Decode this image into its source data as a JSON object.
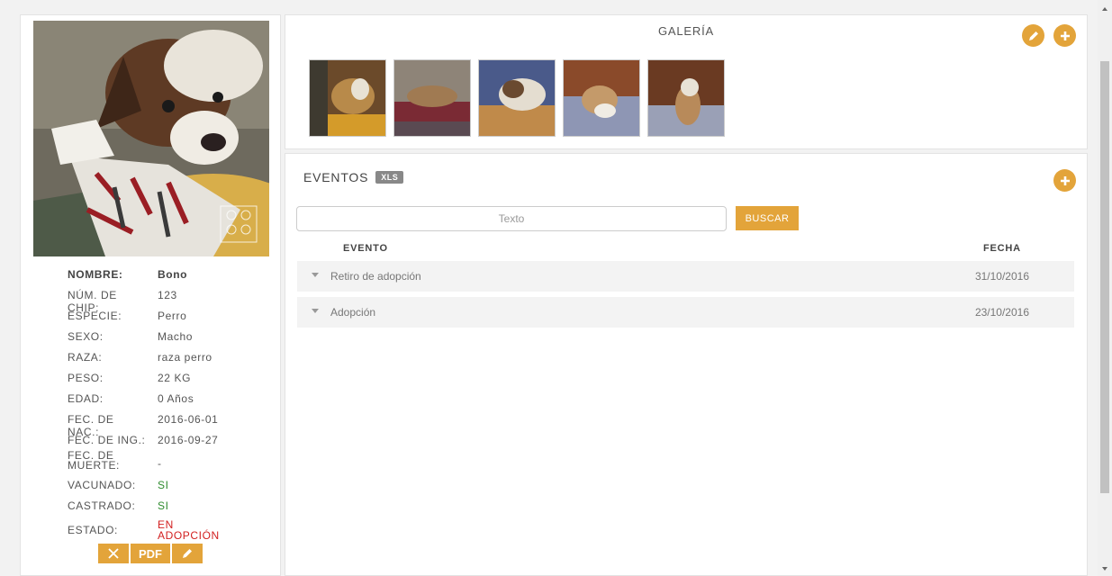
{
  "profile": {
    "rows": [
      {
        "label": "NOMBRE:",
        "value": "Bono"
      },
      {
        "label": "NÚM. DE CHIP:",
        "value": "123"
      },
      {
        "label": "ESPECIE:",
        "value": "Perro"
      },
      {
        "label": "SEXO:",
        "value": "Macho"
      },
      {
        "label": "RAZA:",
        "value": "raza perro"
      },
      {
        "label": "PESO:",
        "value": "22 KG"
      },
      {
        "label": "EDAD:",
        "value": "0 Años"
      },
      {
        "label": "FEC. DE NAC.:",
        "value": "2016-06-01"
      },
      {
        "label": "FEC. DE ING.:",
        "value": "2016-09-27"
      },
      {
        "label": "FEC. DE MUERTE:",
        "value": "-"
      },
      {
        "label": "VACUNADO:",
        "value": "SI"
      },
      {
        "label": "CASTRADO:",
        "value": "SI"
      },
      {
        "label": "ESTADO:",
        "value": "EN ADOPCIÓN"
      }
    ],
    "actions": {
      "pdf_label": "PDF"
    }
  },
  "gallery": {
    "title": "GALERÍA"
  },
  "events": {
    "title": "EVENTOS",
    "xls_label": "XLS",
    "search_placeholder": "Texto",
    "search_button": "BUSCAR",
    "col_event": "EVENTO",
    "col_date": "FECHA",
    "rows": [
      {
        "name": "Retiro de adopción",
        "date": "31/10/2016"
      },
      {
        "name": "Adopción",
        "date": "23/10/2016"
      }
    ]
  },
  "colors": {
    "accent": "#e3a43a",
    "success": "#2e8b2e",
    "danger": "#d21f1f"
  }
}
